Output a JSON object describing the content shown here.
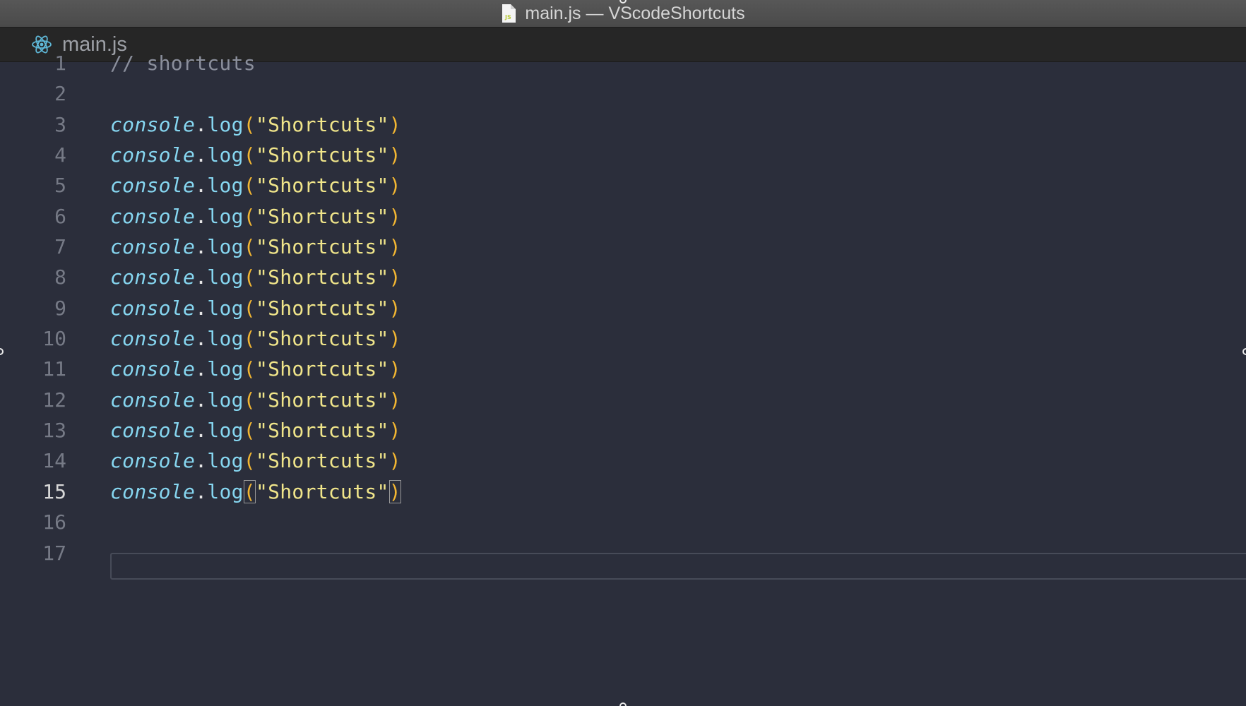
{
  "window": {
    "title": "main.js — VScodeShortcuts",
    "title_icon": "js-file-icon"
  },
  "tabs": [
    {
      "label": "main.js",
      "icon": "react-atom-icon",
      "active": true
    }
  ],
  "editor": {
    "active_line": 15,
    "lines": [
      {
        "num": "1",
        "code": "// shortcuts",
        "kind": "comment"
      },
      {
        "num": "2",
        "code": "",
        "kind": "empty"
      },
      {
        "num": "3",
        "obj": "console",
        "fn": "log",
        "arg": "\"Shortcuts\"",
        "kind": "call"
      },
      {
        "num": "4",
        "obj": "console",
        "fn": "log",
        "arg": "\"Shortcuts\"",
        "kind": "call"
      },
      {
        "num": "5",
        "obj": "console",
        "fn": "log",
        "arg": "\"Shortcuts\"",
        "kind": "call"
      },
      {
        "num": "6",
        "obj": "console",
        "fn": "log",
        "arg": "\"Shortcuts\"",
        "kind": "call"
      },
      {
        "num": "7",
        "obj": "console",
        "fn": "log",
        "arg": "\"Shortcuts\"",
        "kind": "call"
      },
      {
        "num": "8",
        "obj": "console",
        "fn": "log",
        "arg": "\"Shortcuts\"",
        "kind": "call"
      },
      {
        "num": "9",
        "obj": "console",
        "fn": "log",
        "arg": "\"Shortcuts\"",
        "kind": "call"
      },
      {
        "num": "10",
        "obj": "console",
        "fn": "log",
        "arg": "\"Shortcuts\"",
        "kind": "call"
      },
      {
        "num": "11",
        "obj": "console",
        "fn": "log",
        "arg": "\"Shortcuts\"",
        "kind": "call"
      },
      {
        "num": "12",
        "obj": "console",
        "fn": "log",
        "arg": "\"Shortcuts\"",
        "kind": "call"
      },
      {
        "num": "13",
        "obj": "console",
        "fn": "log",
        "arg": "\"Shortcuts\"",
        "kind": "call"
      },
      {
        "num": "14",
        "obj": "console",
        "fn": "log",
        "arg": "\"Shortcuts\"",
        "kind": "call"
      },
      {
        "num": "15",
        "obj": "console",
        "fn": "log",
        "arg": "\"Shortcuts\"",
        "kind": "call"
      },
      {
        "num": "16",
        "code": "",
        "kind": "empty"
      },
      {
        "num": "17",
        "code": "",
        "kind": "empty"
      }
    ]
  },
  "colors": {
    "editor_bg": "#2b2e3b",
    "comment": "#8b8f9c",
    "identifier": "#86d6f0",
    "paren": "#f2b632",
    "string": "#f0e58a"
  }
}
